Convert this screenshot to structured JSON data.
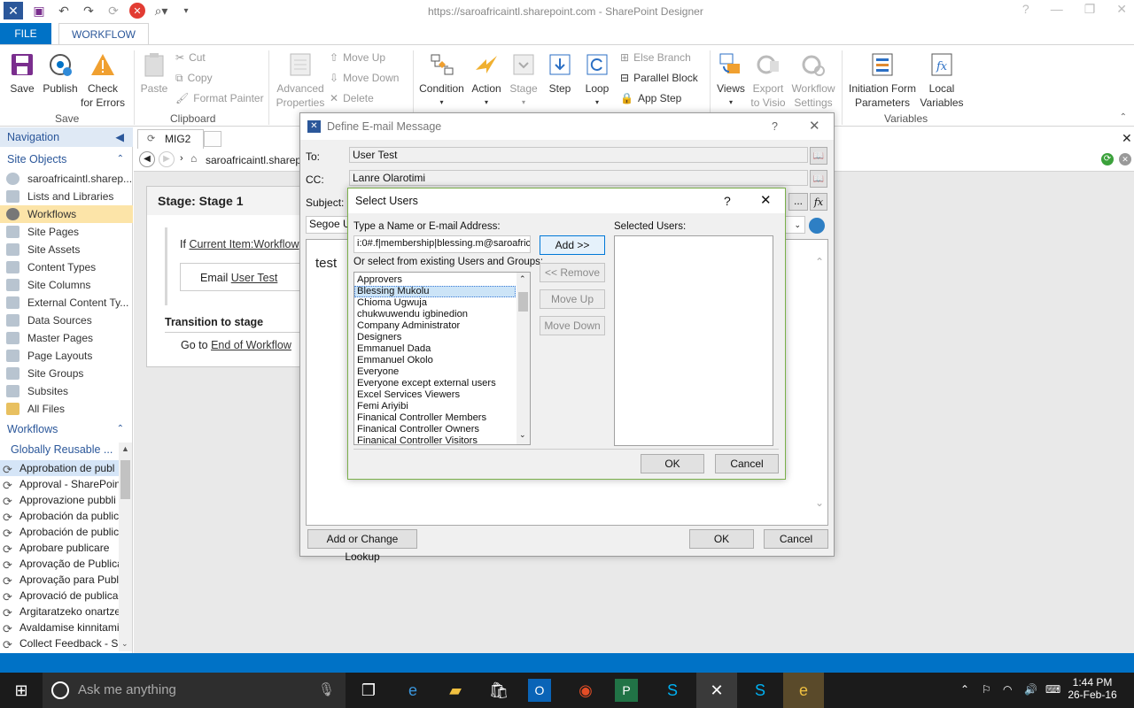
{
  "window": {
    "title": "https://saroafricaintl.sharepoint.com - SharePoint Designer"
  },
  "ribbon": {
    "tabs": [
      {
        "label": "FILE"
      },
      {
        "label": "WORKFLOW"
      }
    ],
    "save": {
      "save": "Save",
      "publish": "Publish",
      "check": "Check",
      "check2": "for Errors",
      "group": "Save"
    },
    "clipboard": {
      "paste": "Paste",
      "cut": "Cut",
      "copy": "Copy",
      "format_painter": "Format Painter",
      "group": "Clipboard"
    },
    "modify": {
      "advanced": "Advanced",
      "properties": "Properties",
      "move_up": "Move Up",
      "move_down": "Move Down",
      "delete": "Delete"
    },
    "insert": {
      "condition": "Condition",
      "action": "Action",
      "stage": "Stage",
      "step": "Step",
      "loop": "Loop",
      "else_branch": "Else Branch",
      "parallel_block": "Parallel Block",
      "app_step": "App Step"
    },
    "manage": {
      "views": "Views",
      "export": "Export",
      "to_visio": "to Visio",
      "workflow": "Workflow",
      "settings": "Settings"
    },
    "variables": {
      "initiation": "Initiation Form",
      "parameters": "Parameters",
      "local": "Local",
      "variables": "Variables",
      "group": "Variables"
    }
  },
  "nav": {
    "title": "Navigation",
    "site_objects_header": "Site Objects",
    "items": [
      {
        "label": "saroafricaintl.sharep..."
      },
      {
        "label": "Lists and Libraries"
      },
      {
        "label": "Workflows"
      },
      {
        "label": "Site Pages"
      },
      {
        "label": "Site Assets"
      },
      {
        "label": "Content Types"
      },
      {
        "label": "Site Columns"
      },
      {
        "label": "External Content Ty..."
      },
      {
        "label": "Data Sources"
      },
      {
        "label": "Master Pages"
      },
      {
        "label": "Page Layouts"
      },
      {
        "label": "Site Groups"
      },
      {
        "label": "Subsites"
      },
      {
        "label": "All Files"
      }
    ],
    "workflows_header": "Workflows",
    "globally_reusable": "Globally Reusable ...",
    "workflows": [
      {
        "label": "Approbation de publ"
      },
      {
        "label": "Approval - SharePoint"
      },
      {
        "label": "Approvazione pubbli"
      },
      {
        "label": "Aprobación da public"
      },
      {
        "label": "Aprobación de public"
      },
      {
        "label": "Aprobare publicare"
      },
      {
        "label": "Aprovação de Publica"
      },
      {
        "label": "Aprovação para Publi"
      },
      {
        "label": "Aprovació de publicac"
      },
      {
        "label": "Argitaratzeko onartze"
      },
      {
        "label": "Avaldamise kinnitamin"
      },
      {
        "label": "Collect Feedback - Sh"
      }
    ]
  },
  "editor": {
    "doc_tab": "MIG2",
    "address": "saroafricaintl.sharep",
    "stage_title": "Stage: Stage 1",
    "if_label": "If",
    "if_field": "Current Item:Workflow",
    "email_label": "Email",
    "email_target": "User Test",
    "transition": "Transition to stage",
    "goto": "Go to",
    "goto_target": "End of Workflow"
  },
  "email_dialog": {
    "title": "Define E-mail Message",
    "to_label": "To:",
    "to_value": "User Test",
    "cc_label": "CC:",
    "cc_value": "Lanre Olarotimi",
    "subject_label": "Subject:",
    "font": "Segoe UI",
    "body": "test",
    "lookup_btn": "Add or Change Lookup",
    "ok": "OK",
    "cancel": "Cancel",
    "fx": "fx",
    "ellipsis": "..."
  },
  "select_users": {
    "title": "Select Users",
    "help": "?",
    "type_label": "Type a Name or E-mail Address:",
    "type_value": "i:0#.f|membership|blessing.m@saroafric",
    "existing_label": "Or select from existing Users and Groups:",
    "selected_label": "Selected Users:",
    "add": "Add >>",
    "remove": "<< Remove",
    "move_up": "Move Up",
    "move_down": "Move Down",
    "ok": "OK",
    "cancel": "Cancel",
    "users": [
      {
        "label": "Approvers"
      },
      {
        "label": "Blessing Mukolu"
      },
      {
        "label": "Chioma Ugwuja"
      },
      {
        "label": "chukwuwendu igbinedion"
      },
      {
        "label": "Company Administrator"
      },
      {
        "label": "Designers"
      },
      {
        "label": "Emmanuel Dada"
      },
      {
        "label": "Emmanuel Okolo"
      },
      {
        "label": "Everyone"
      },
      {
        "label": "Everyone except external users"
      },
      {
        "label": "Excel Services Viewers"
      },
      {
        "label": "Femi Ariyibi"
      },
      {
        "label": "Finanical Controller Members"
      },
      {
        "label": "Finanical Controller Owners"
      },
      {
        "label": "Finanical Controller Visitors"
      }
    ]
  },
  "taskbar": {
    "search": "Ask me anything",
    "time": "1:44 PM",
    "date": "26-Feb-16"
  },
  "colors": {
    "accent": "#0072c6",
    "selection": "#fce4a8",
    "dialog_border": "#7bb04b"
  }
}
